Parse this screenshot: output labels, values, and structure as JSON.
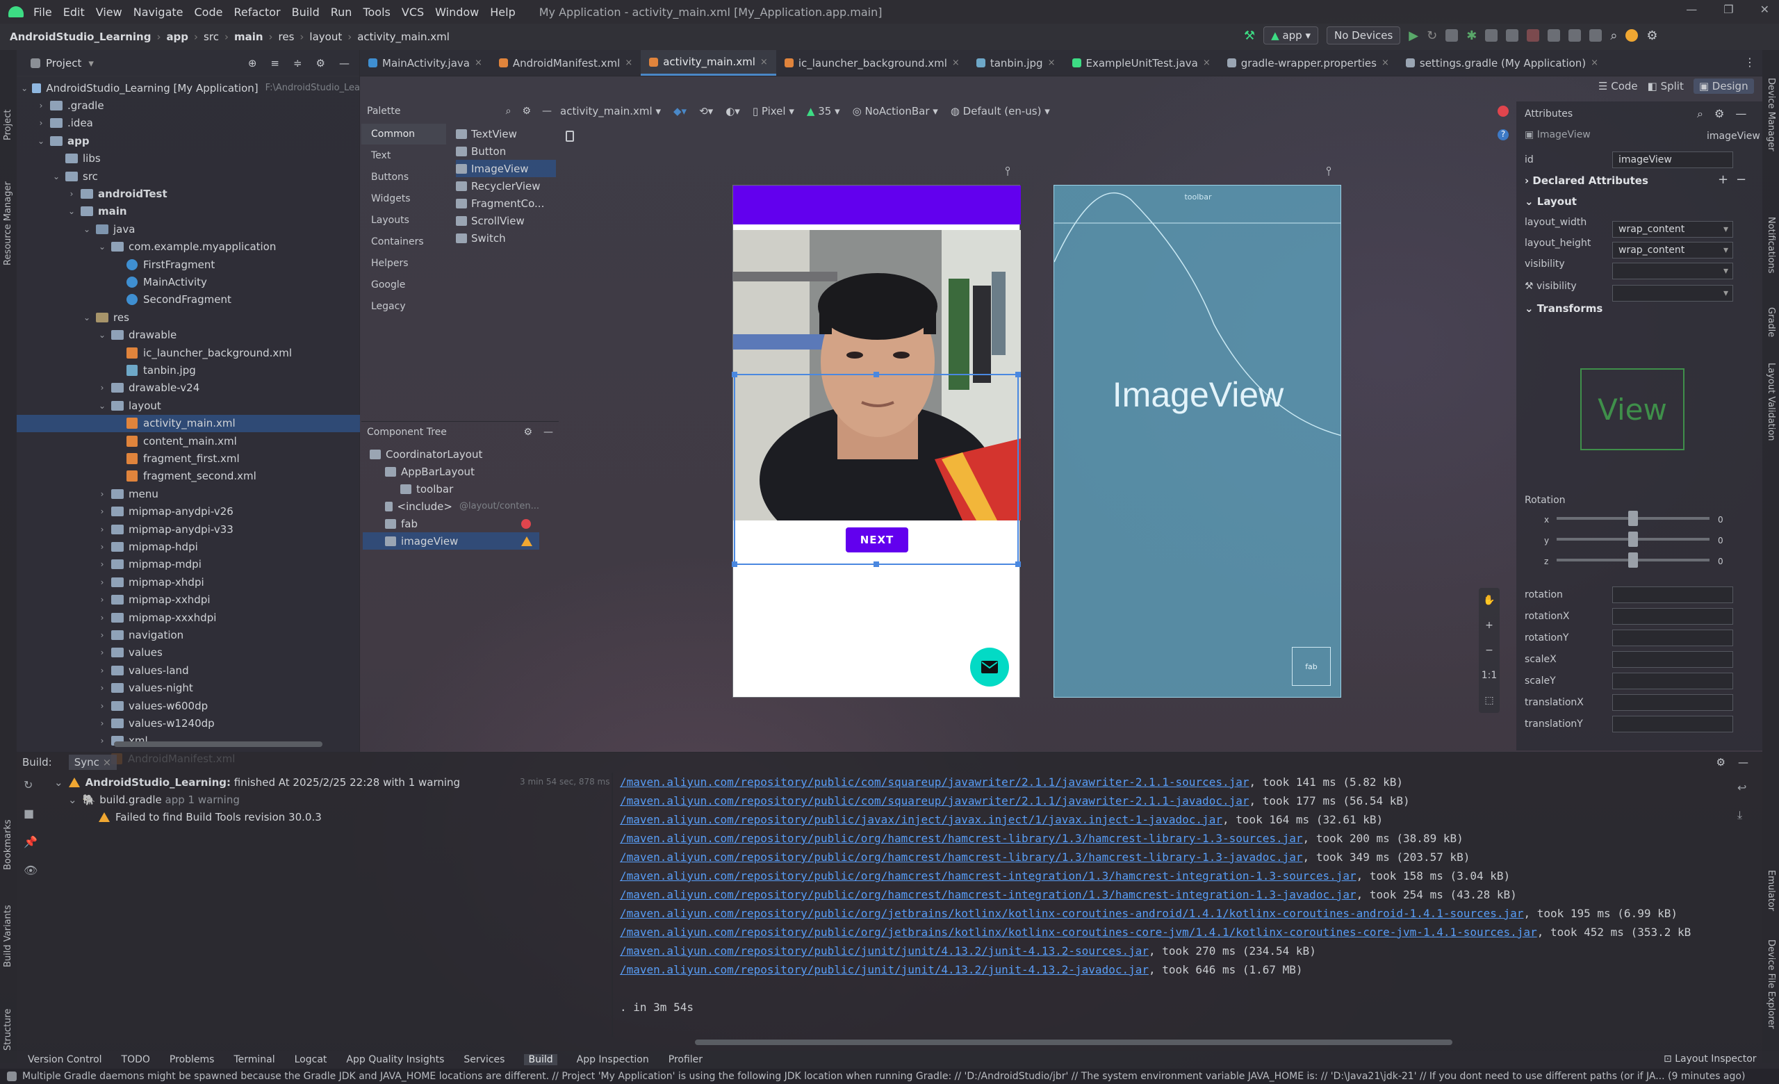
{
  "window": {
    "title": "My Application - activity_main.xml [My_Application.app.main]"
  },
  "menu": [
    "File",
    "Edit",
    "View",
    "Navigate",
    "Code",
    "Refactor",
    "Build",
    "Run",
    "Tools",
    "VCS",
    "Window",
    "Help"
  ],
  "breadcrumb": {
    "project": "AndroidStudio_Learning",
    "items": [
      "app",
      "src",
      "main",
      "res",
      "layout",
      "activity_main.xml"
    ]
  },
  "toolbar": {
    "run_config": "app",
    "device": "No Devices"
  },
  "project_panel": {
    "title": "Project",
    "tree": [
      {
        "label": "AndroidStudio_Learning [My Application]",
        "extra": "F:\\AndroidStudio_Lea",
        "kind": "module",
        "depth": 0,
        "open": true
      },
      {
        "label": ".gradle",
        "kind": "folder",
        "depth": 1,
        "open": false
      },
      {
        "label": ".idea",
        "kind": "folder",
        "depth": 1,
        "open": false
      },
      {
        "label": "app",
        "kind": "folder",
        "depth": 1,
        "open": true,
        "bold": true
      },
      {
        "label": "libs",
        "kind": "folder",
        "depth": 2
      },
      {
        "label": "src",
        "kind": "folder",
        "depth": 2,
        "open": true
      },
      {
        "label": "androidTest",
        "kind": "folder",
        "depth": 3,
        "open": false,
        "bold": true
      },
      {
        "label": "main",
        "kind": "folder",
        "depth": 3,
        "open": true,
        "bold": true
      },
      {
        "label": "java",
        "kind": "src",
        "depth": 4,
        "open": true
      },
      {
        "label": "com.example.myapplication",
        "kind": "folder",
        "depth": 5,
        "open": true
      },
      {
        "label": "FirstFragment",
        "kind": "class",
        "depth": 6
      },
      {
        "label": "MainActivity",
        "kind": "class",
        "depth": 6
      },
      {
        "label": "SecondFragment",
        "kind": "class",
        "depth": 6
      },
      {
        "label": "res",
        "kind": "res",
        "depth": 4,
        "open": true
      },
      {
        "label": "drawable",
        "kind": "folder",
        "depth": 5,
        "open": true
      },
      {
        "label": "ic_launcher_background.xml",
        "kind": "xml",
        "depth": 6
      },
      {
        "label": "tanbin.jpg",
        "kind": "img",
        "depth": 6
      },
      {
        "label": "drawable-v24",
        "kind": "folder",
        "depth": 5,
        "open": false
      },
      {
        "label": "layout",
        "kind": "folder",
        "depth": 5,
        "open": true
      },
      {
        "label": "activity_main.xml",
        "kind": "xml",
        "depth": 6,
        "selected": true
      },
      {
        "label": "content_main.xml",
        "kind": "xml",
        "depth": 6
      },
      {
        "label": "fragment_first.xml",
        "kind": "xml",
        "depth": 6
      },
      {
        "label": "fragment_second.xml",
        "kind": "xml",
        "depth": 6
      },
      {
        "label": "menu",
        "kind": "folder",
        "depth": 5,
        "open": false
      },
      {
        "label": "mipmap-anydpi-v26",
        "kind": "folder",
        "depth": 5,
        "open": false
      },
      {
        "label": "mipmap-anydpi-v33",
        "kind": "folder",
        "depth": 5,
        "open": false
      },
      {
        "label": "mipmap-hdpi",
        "kind": "folder",
        "depth": 5,
        "open": false
      },
      {
        "label": "mipmap-mdpi",
        "kind": "folder",
        "depth": 5,
        "open": false
      },
      {
        "label": "mipmap-xhdpi",
        "kind": "folder",
        "depth": 5,
        "open": false
      },
      {
        "label": "mipmap-xxhdpi",
        "kind": "folder",
        "depth": 5,
        "open": false
      },
      {
        "label": "mipmap-xxxhdpi",
        "kind": "folder",
        "depth": 5,
        "open": false
      },
      {
        "label": "navigation",
        "kind": "folder",
        "depth": 5,
        "open": false
      },
      {
        "label": "values",
        "kind": "folder",
        "depth": 5,
        "open": false
      },
      {
        "label": "values-land",
        "kind": "folder",
        "depth": 5,
        "open": false
      },
      {
        "label": "values-night",
        "kind": "folder",
        "depth": 5,
        "open": false
      },
      {
        "label": "values-w600dp",
        "kind": "folder",
        "depth": 5,
        "open": false
      },
      {
        "label": "values-w1240dp",
        "kind": "folder",
        "depth": 5,
        "open": false
      },
      {
        "label": "xml",
        "kind": "folder",
        "depth": 5,
        "open": false
      },
      {
        "label": "AndroidManifest.xml",
        "kind": "xml",
        "depth": 5
      }
    ]
  },
  "tabs": [
    {
      "label": "MainActivity.java",
      "color": "#3f8fd1"
    },
    {
      "label": "AndroidManifest.xml",
      "color": "#e0843c"
    },
    {
      "label": "activity_main.xml",
      "color": "#e0843c",
      "active": true
    },
    {
      "label": "ic_launcher_background.xml",
      "color": "#e0843c"
    },
    {
      "label": "tanbin.jpg",
      "color": "#6ea8c8"
    },
    {
      "label": "ExampleUnitTest.java",
      "color": "#3ddc84"
    },
    {
      "label": "gradle-wrapper.properties",
      "color": "#9aa5b3"
    },
    {
      "label": "settings.gradle (My Application)",
      "color": "#9aa5b3"
    }
  ],
  "view_modes": {
    "code": "Code",
    "split": "Split",
    "design": "Design"
  },
  "palette": {
    "title": "Palette",
    "categories": [
      "Common",
      "Text",
      "Buttons",
      "Widgets",
      "Layouts",
      "Containers",
      "Helpers",
      "Google",
      "Legacy"
    ],
    "items": [
      "TextView",
      "Button",
      "ImageView",
      "RecyclerView",
      "FragmentCo...",
      "ScrollView",
      "Switch"
    ]
  },
  "design_toolbar": {
    "file": "activity_main.xml",
    "device": "Pixel",
    "api": "35",
    "theme": "NoActionBar",
    "locale": "Default (en-us)"
  },
  "component_tree": {
    "title": "Component Tree",
    "rows": [
      {
        "label": "CoordinatorLayout",
        "depth": 0
      },
      {
        "label": "AppBarLayout",
        "depth": 1
      },
      {
        "label": "toolbar",
        "depth": 2
      },
      {
        "label": "<include>",
        "extra": "@layout/conten...",
        "depth": 1
      },
      {
        "label": "fab",
        "depth": 1,
        "status": "error"
      },
      {
        "label": "imageView",
        "depth": 1,
        "status": "warning",
        "selected": true
      }
    ]
  },
  "design": {
    "next_button": "NEXT",
    "blueprint_label": "ImageView",
    "blueprint_toolbar": "toolbar",
    "blueprint_fab": "fab",
    "appbar_color": "#6200ee",
    "fab_color": "#03dac5"
  },
  "zoom": {
    "ratio": "1:1"
  },
  "attributes": {
    "title": "Attributes",
    "component": "ImageView",
    "component_id": "imageView",
    "id_label": "id",
    "id_value": "imageView",
    "declared": "Declared Attributes",
    "layout": "Layout",
    "layout_width_label": "layout_width",
    "layout_width": "wrap_content",
    "layout_height_label": "layout_height",
    "layout_height": "wrap_content",
    "visibility_label": "visibility",
    "visibility2_label": "visibility",
    "transforms": "Transforms",
    "view_preview": "View",
    "rotation_title": "Rotation",
    "rot_x": "x",
    "rot_y": "y",
    "rot_z": "z",
    "rot_x_val": "0",
    "rot_y_val": "0",
    "rot_z_val": "0",
    "fields": [
      "rotation",
      "rotationX",
      "rotationY",
      "scaleX",
      "scaleY",
      "translationX",
      "translationY"
    ]
  },
  "build": {
    "tabs": [
      "Build:",
      "Sync"
    ],
    "project": "AndroidStudio_Learning:",
    "status": "finished",
    "time": "At 2025/2/25 22:28 with 1 warning",
    "duration": "3 min 54 sec, 878 ms",
    "gradle_file": "build.gradle",
    "gradle_detail": "app 1 warning",
    "warning": "Failed to find Build Tools revision 30.0.3",
    "log": [
      {
        "url": "/maven.aliyun.com/repository/public/com/squareup/javawriter/2.1.1/javawriter-2.1.1-sources.jar",
        "rest": ", took 141 ms (5.82 kB)"
      },
      {
        "url": "/maven.aliyun.com/repository/public/com/squareup/javawriter/2.1.1/javawriter-2.1.1-javadoc.jar",
        "rest": ", took 177 ms (56.54 kB)"
      },
      {
        "url": "/maven.aliyun.com/repository/public/javax/inject/javax.inject/1/javax.inject-1-javadoc.jar",
        "rest": ", took 164 ms (32.61 kB)"
      },
      {
        "url": "/maven.aliyun.com/repository/public/org/hamcrest/hamcrest-library/1.3/hamcrest-library-1.3-sources.jar",
        "rest": ", took 200 ms (38.89 kB)"
      },
      {
        "url": "/maven.aliyun.com/repository/public/org/hamcrest/hamcrest-library/1.3/hamcrest-library-1.3-javadoc.jar",
        "rest": ", took 349 ms (203.57 kB)"
      },
      {
        "url": "/maven.aliyun.com/repository/public/org/hamcrest/hamcrest-integration/1.3/hamcrest-integration-1.3-sources.jar",
        "rest": ", took 158 ms (3.04 kB)"
      },
      {
        "url": "/maven.aliyun.com/repository/public/org/hamcrest/hamcrest-integration/1.3/hamcrest-integration-1.3-javadoc.jar",
        "rest": ", took 254 ms (43.28 kB)"
      },
      {
        "url": "/maven.aliyun.com/repository/public/org/jetbrains/kotlinx/kotlinx-coroutines-android/1.4.1/kotlinx-coroutines-android-1.4.1-sources.jar",
        "rest": ", took 195 ms (6.99 kB)"
      },
      {
        "url": "/maven.aliyun.com/repository/public/org/jetbrains/kotlinx/kotlinx-coroutines-core-jvm/1.4.1/kotlinx-coroutines-core-jvm-1.4.1-sources.jar",
        "rest": ", took 452 ms (353.2 kB"
      },
      {
        "url": "/maven.aliyun.com/repository/public/junit/junit/4.13.2/junit-4.13.2-sources.jar",
        "rest": ", took 270 ms (234.54 kB)"
      },
      {
        "url": "/maven.aliyun.com/repository/public/junit/junit/4.13.2/junit-4.13.2-javadoc.jar",
        "rest": ", took 646 ms (1.67 MB)"
      }
    ],
    "footer": ". in 3m 54s"
  },
  "tool_windows": [
    "Version Control",
    "TODO",
    "Problems",
    "Terminal",
    "Logcat",
    "App Quality Insights",
    "Services",
    "Build",
    "App Inspection",
    "Profiler"
  ],
  "layout_inspector": "Layout Inspector",
  "left_strip": [
    "Project",
    "Resource Manager",
    "Bookmarks",
    "Build Variants",
    "Structure"
  ],
  "right_strip": [
    "Device Manager",
    "Notifications",
    "Gradle",
    "Layout Validation",
    "Emulator",
    "Device File Explorer"
  ],
  "status_message": "Multiple Gradle daemons might be spawned because the Gradle JDK and JAVA_HOME locations are different. // Project 'My Application' is using the following JDK location when running Gradle: // 'D:/AndroidStudio/jbr' // The system environment variable JAVA_HOME is: // 'D:\\Java21\\jdk-21' // If you dont need to use different paths (or if JA... (9 minutes ago)"
}
